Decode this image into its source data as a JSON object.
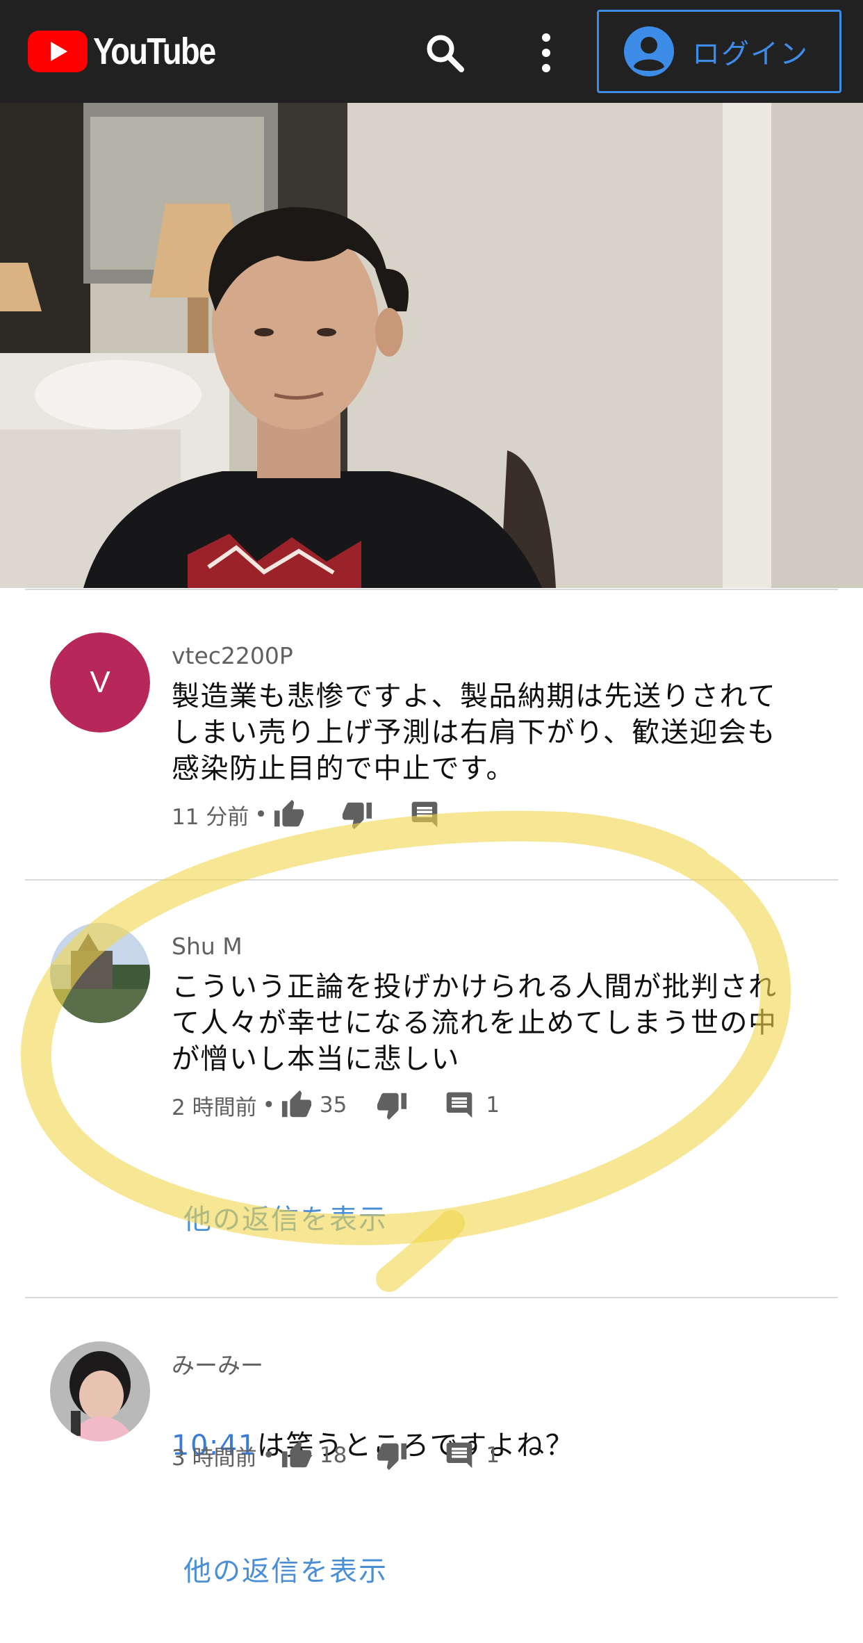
{
  "header": {
    "logo_text": "YouTube",
    "login_label": "ログイン",
    "icons": [
      "youtube-logo-icon",
      "search-icon",
      "more-vert-icon",
      "account-circle-icon"
    ],
    "colors": {
      "bar": "#212121",
      "brand_red": "#ff0000",
      "login_blue": "#3d8ce8"
    }
  },
  "comments": [
    {
      "author": "vtec2200P",
      "avatar_letter": "V",
      "avatar_color": "#b8275a",
      "text": "製造業も悲惨ですよ、製品納期は先送りされて\nしまい売り上げ予測は右肩下がり、歓送迎会も\n感染防止目的で中止です。",
      "time": "11 分前",
      "separator": "•"
    },
    {
      "author": "Shu M",
      "text": "こういう正論を投げかけられる人間が批判され\nて人々が幸せになる流れを止めてしまう世の中\nが憎いし本当に悲しい",
      "time": "2 時間前",
      "separator": "•",
      "likes": "35",
      "replies_count": "1",
      "show_replies": "他の返信を表示"
    },
    {
      "author": "みーみー",
      "timestamp_link": "10:41",
      "text_after_link": "は笑うところですよね？",
      "time": "3 時間前",
      "separator": "•",
      "likes": "18",
      "replies_count": "1",
      "show_replies": "他の返信を表示"
    }
  ],
  "annotation_color": "#f2d64b"
}
